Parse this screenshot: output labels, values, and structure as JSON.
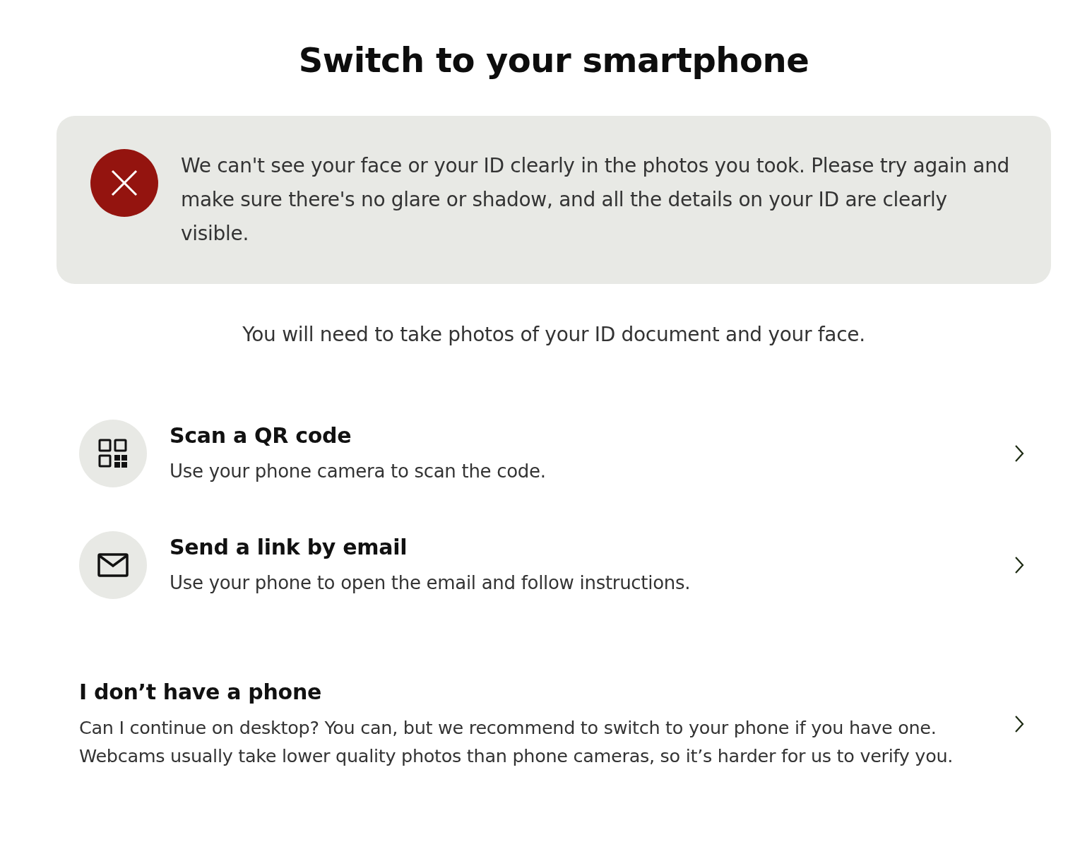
{
  "title": "Switch to your smartphone",
  "alert": {
    "kind": "error",
    "message": "We can't see your face or your ID clearly in the photos you took. Please try again and make sure there's no glare or shadow, and all the details on your ID are clearly visible."
  },
  "intro": "You will need to take photos of your ID document and your face.",
  "options": [
    {
      "kind": "qr",
      "title": "Scan a QR code",
      "description": "Use your phone camera to scan the code."
    },
    {
      "kind": "email",
      "title": "Send a link by email",
      "description": "Use your phone to open the email and follow instructions."
    }
  ],
  "no_phone": {
    "title": "I don’t have a phone",
    "description": "Can I continue on desktop? You can, but we recommend to switch to your phone if you have one. Webcams usually take lower quality photos than phone cameras, so it’s harder for us to verify you."
  }
}
